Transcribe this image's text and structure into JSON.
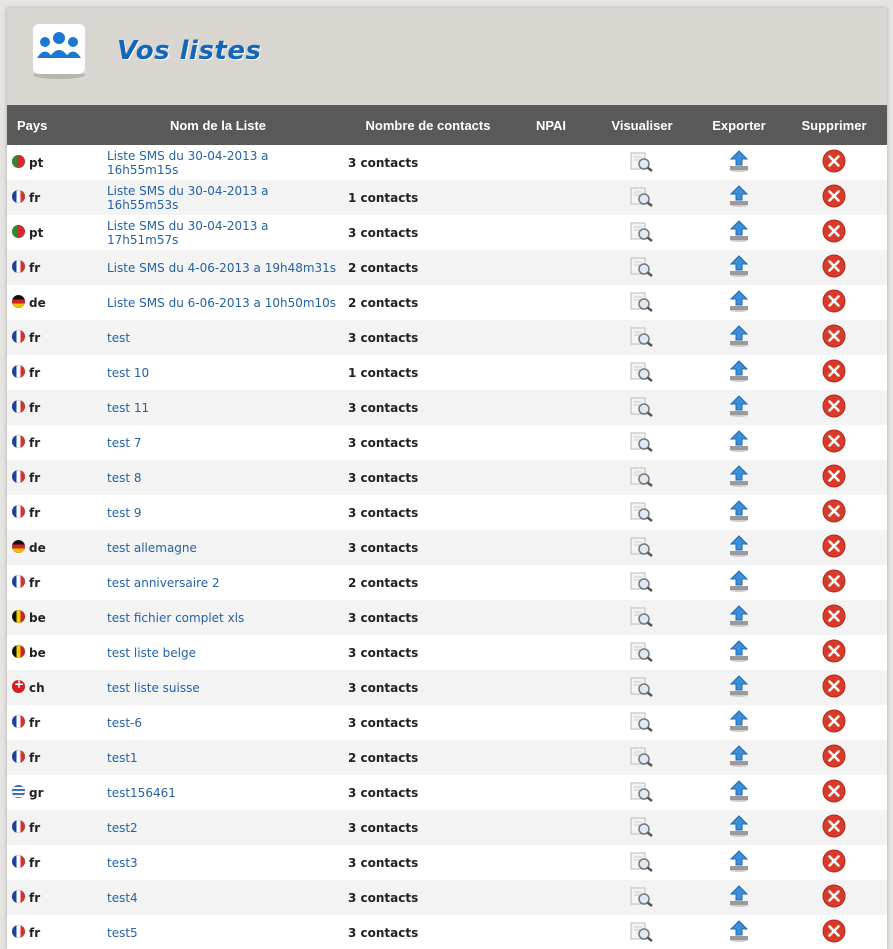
{
  "header": {
    "title": "Vos listes",
    "logo_icon": "users-group-icon"
  },
  "table": {
    "columns": [
      "Pays",
      "Nom de la Liste",
      "Nombre de contacts",
      "NPAI",
      "Visualiser",
      "Exporter",
      "Supprimer"
    ],
    "action_icons": {
      "view": "magnifier-icon",
      "export": "upload-arrow-icon",
      "delete": "delete-icon"
    },
    "rows": [
      {
        "country": "pt",
        "name": "Liste SMS du 30-04-2013 a 16h55m15s",
        "contacts": "3 contacts",
        "npai": ""
      },
      {
        "country": "fr",
        "name": "Liste SMS du 30-04-2013 a 16h55m53s",
        "contacts": "1 contacts",
        "npai": ""
      },
      {
        "country": "pt",
        "name": "Liste SMS du 30-04-2013 a 17h51m57s",
        "contacts": "3 contacts",
        "npai": ""
      },
      {
        "country": "fr",
        "name": "Liste SMS du 4-06-2013 a 19h48m31s",
        "contacts": "2 contacts",
        "npai": ""
      },
      {
        "country": "de",
        "name": "Liste SMS du 6-06-2013 a 10h50m10s",
        "contacts": "2 contacts",
        "npai": ""
      },
      {
        "country": "fr",
        "name": "test",
        "contacts": "3 contacts",
        "npai": ""
      },
      {
        "country": "fr",
        "name": "test 10",
        "contacts": "1 contacts",
        "npai": ""
      },
      {
        "country": "fr",
        "name": "test 11",
        "contacts": "3 contacts",
        "npai": ""
      },
      {
        "country": "fr",
        "name": "test 7",
        "contacts": "3 contacts",
        "npai": ""
      },
      {
        "country": "fr",
        "name": "test 8",
        "contacts": "3 contacts",
        "npai": ""
      },
      {
        "country": "fr",
        "name": "test 9",
        "contacts": "3 contacts",
        "npai": ""
      },
      {
        "country": "de",
        "name": "test allemagne",
        "contacts": "3 contacts",
        "npai": ""
      },
      {
        "country": "fr",
        "name": "test anniversaire 2",
        "contacts": "2 contacts",
        "npai": ""
      },
      {
        "country": "be",
        "name": "test fichier complet xls",
        "contacts": "3 contacts",
        "npai": ""
      },
      {
        "country": "be",
        "name": "test liste belge",
        "contacts": "3 contacts",
        "npai": ""
      },
      {
        "country": "ch",
        "name": "test liste suisse",
        "contacts": "3 contacts",
        "npai": ""
      },
      {
        "country": "fr",
        "name": "test-6",
        "contacts": "3 contacts",
        "npai": ""
      },
      {
        "country": "fr",
        "name": "test1",
        "contacts": "2 contacts",
        "npai": ""
      },
      {
        "country": "gr",
        "name": "test156461",
        "contacts": "3 contacts",
        "npai": ""
      },
      {
        "country": "fr",
        "name": "test2",
        "contacts": "3 contacts",
        "npai": ""
      },
      {
        "country": "fr",
        "name": "test3",
        "contacts": "3 contacts",
        "npai": ""
      },
      {
        "country": "fr",
        "name": "test4",
        "contacts": "3 contacts",
        "npai": ""
      },
      {
        "country": "fr",
        "name": "test5",
        "contacts": "3 contacts",
        "npai": ""
      }
    ]
  },
  "colors": {
    "title": "#1666b8",
    "header_bg": "#d9d6d1",
    "table_head_bg": "#595959",
    "link": "#2462a6",
    "delete_red": "#d93a2a",
    "export_blue": "#3a8fd8"
  }
}
